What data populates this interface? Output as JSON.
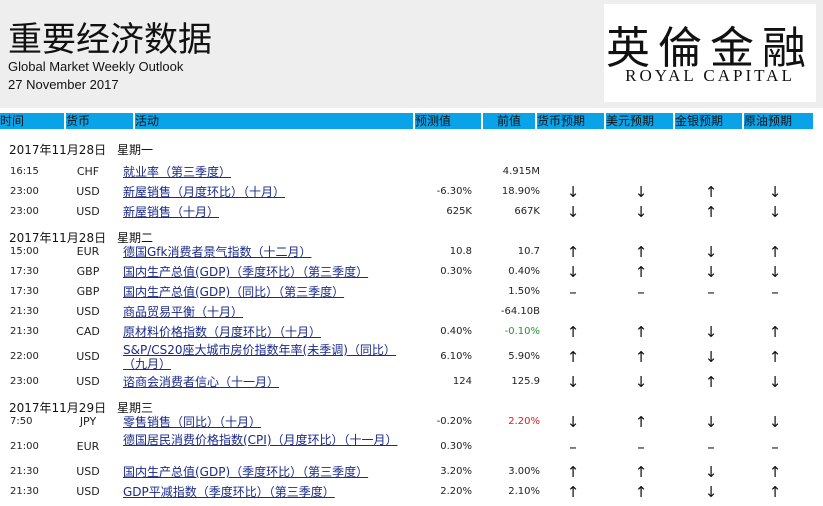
{
  "header": {
    "title": "重要经济数据",
    "subtitle": "Global Market Weekly Outlook",
    "date": "27 November 2017"
  },
  "logo": {
    "cn": "英倫金融",
    "en": "ROYAL CAPITAL"
  },
  "columns": [
    "时间",
    "货币",
    "活动",
    "预测值",
    "前值",
    "货币预期",
    "美元预期",
    "金银预期",
    "原油预期"
  ],
  "colors": {
    "header_bar": "#0aa3e8",
    "positive": "#1a9a2a",
    "negative": "#d62020",
    "link": "#1a2a8a"
  },
  "rows": [
    {
      "type": "section",
      "date": "2017年11月28日",
      "day": "星期一"
    },
    {
      "type": "event",
      "time": "16:15",
      "currency": "CHF",
      "activity": "就业率（第三季度）",
      "forecast": "",
      "previous": "4.915M",
      "arrows": [
        "",
        "",
        "",
        ""
      ]
    },
    {
      "type": "event",
      "time": "23:00",
      "currency": "USD",
      "activity": "新屋销售（月度环比）（十月）",
      "forecast": "-6.30%",
      "previous": "18.90%",
      "arrows": [
        "↓",
        "↓",
        "↑",
        "↓"
      ]
    },
    {
      "type": "event",
      "time": "23:00",
      "currency": "USD",
      "activity": "新屋销售（十月）",
      "forecast": "625K",
      "previous": "667K",
      "arrows": [
        "↓",
        "↓",
        "↑",
        "↓"
      ]
    },
    {
      "type": "section",
      "date": "2017年11月28日",
      "day": "星期二"
    },
    {
      "type": "event",
      "time": "15:00",
      "currency": "EUR",
      "activity": "德国Gfk消费者景气指数（十二月）",
      "forecast": "10.8",
      "previous": "10.7",
      "arrows": [
        "↑",
        "↑",
        "↓",
        "↑"
      ]
    },
    {
      "type": "event",
      "time": "17:30",
      "currency": "GBP",
      "activity": "国内生产总值(GDP)（季度环比）（第三季度）",
      "forecast": "0.30%",
      "previous": "0.40%",
      "arrows": [
        "↓",
        "↑",
        "↓",
        "↓"
      ]
    },
    {
      "type": "event",
      "time": "17:30",
      "currency": "GBP",
      "activity": "国内生产总值(GDP)（同比）（第三季度）",
      "forecast": "",
      "previous": "1.50%",
      "arrows": [
        "–",
        "–",
        "–",
        "–"
      ]
    },
    {
      "type": "event",
      "time": "21:30",
      "currency": "USD",
      "activity": "商品贸易平衡（十月）",
      "forecast": "",
      "previous": "-64.10B",
      "arrows": [
        "",
        "",
        "",
        ""
      ]
    },
    {
      "type": "event",
      "time": "21:30",
      "currency": "CAD",
      "activity": "原材料价格指数（月度环比）（十月）",
      "forecast": "0.40%",
      "previous": "-0.10%",
      "previous_color": "green",
      "arrows": [
        "↑",
        "↑",
        "↓",
        "↑"
      ]
    },
    {
      "type": "event",
      "time": "22:00",
      "currency": "USD",
      "activity": "S&P/CS20座大城市房价指数年率(未季调)（同比）（九月）",
      "forecast": "6.10%",
      "previous": "5.90%",
      "tall": true,
      "arrows": [
        "↑",
        "↑",
        "↓",
        "↑"
      ]
    },
    {
      "type": "event",
      "time": "23:00",
      "currency": "USD",
      "activity": "谘商会消费者信心（十一月）",
      "forecast": "124",
      "previous": "125.9",
      "arrows": [
        "↓",
        "↓",
        "↑",
        "↓"
      ]
    },
    {
      "type": "section",
      "date": "2017年11月29日",
      "day": "星期三"
    },
    {
      "type": "event",
      "time": "7:50",
      "currency": "JPY",
      "activity": "零售销售（同比）（十月）",
      "forecast": "-0.20%",
      "previous": "2.20%",
      "previous_color": "red",
      "arrows": [
        "↓",
        "↑",
        "↓",
        "↓"
      ]
    },
    {
      "type": "event",
      "time": "21:00",
      "currency": "EUR",
      "activity": "德国居民消费价格指数(CPI)（月度环比）（十一月）",
      "forecast": "0.30%",
      "previous": "",
      "tall": true,
      "arrows": [
        "–",
        "–",
        "–",
        "–"
      ]
    },
    {
      "type": "event",
      "time": "21:30",
      "currency": "USD",
      "activity": "国内生产总值(GDP)（季度环比）（第三季度）",
      "forecast": "3.20%",
      "previous": "3.00%",
      "arrows": [
        "↑",
        "↑",
        "↓",
        "↑"
      ]
    },
    {
      "type": "event",
      "time": "21:30",
      "currency": "USD",
      "activity": "GDP平减指数（季度环比）（第三季度）",
      "forecast": "2.20%",
      "previous": "2.10%",
      "arrows": [
        "↑",
        "↑",
        "↓",
        "↑"
      ]
    }
  ]
}
